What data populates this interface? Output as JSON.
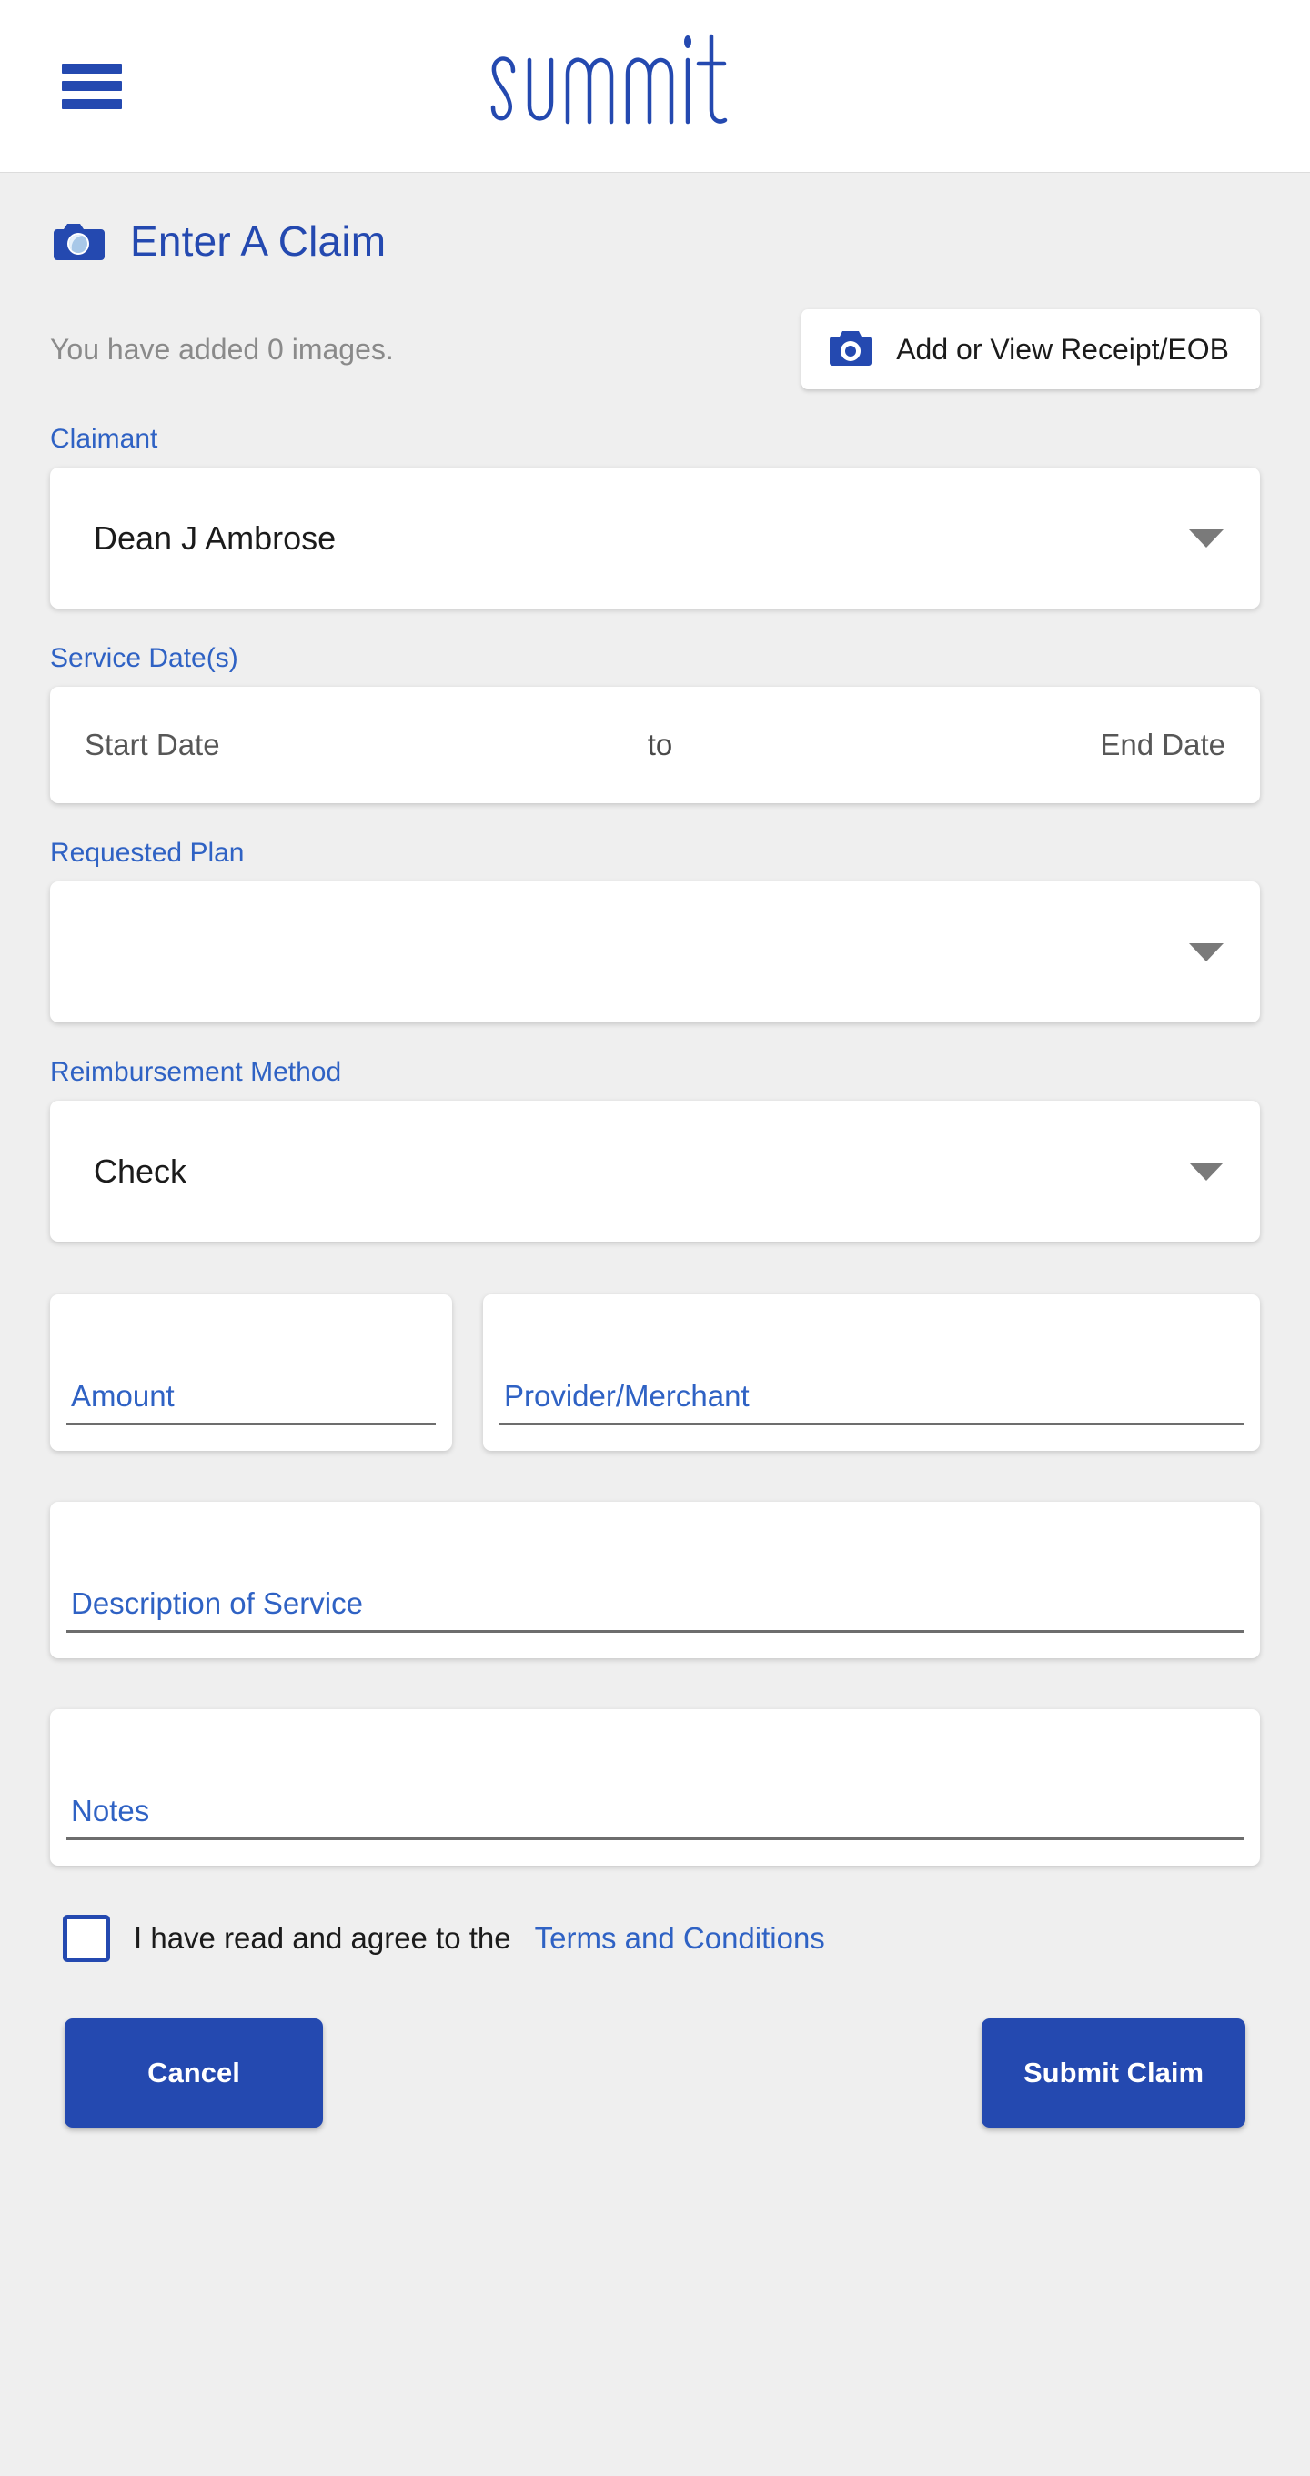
{
  "appbar": {
    "menu_icon": "hamburger-menu-icon",
    "brand": "summit",
    "brand_color": "#2449b0"
  },
  "claim": {
    "header_icon": "camera-icon",
    "header_title": "Enter A Claim",
    "images_status": "You have added 0 images.",
    "receipt_button": {
      "icon": "camera-icon",
      "label": "Add or View Receipt/EOB"
    },
    "claimant": {
      "label": "Claimant",
      "value": "Dean J Ambrose",
      "caret_icon": "chevron-down-icon"
    },
    "service_dates": {
      "label": "Service Date(s)",
      "start_placeholder": "Start Date",
      "separator": "to",
      "end_placeholder": "End Date"
    },
    "requested_plan": {
      "label": "Requested Plan",
      "value": "",
      "caret_icon": "chevron-down-icon"
    },
    "reimbursement_method": {
      "label": "Reimbursement Method",
      "value": "Check",
      "caret_icon": "chevron-down-icon"
    },
    "amount": {
      "label": "Amount",
      "value": ""
    },
    "provider": {
      "label": "Provider/Merchant",
      "value": ""
    },
    "description": {
      "label": "Description of Service",
      "value": ""
    },
    "notes": {
      "label": "Notes",
      "value": ""
    },
    "terms": {
      "checked": false,
      "text": "I have read and agree to the",
      "link": "Terms and Conditions"
    },
    "actions": {
      "cancel": "Cancel",
      "submit": "Submit Claim"
    }
  },
  "colors": {
    "brand_blue": "#2449b0",
    "label_blue": "#2f62c4",
    "page_background": "#efefef",
    "card_background": "#ffffff",
    "muted_text": "#8a8a8a"
  }
}
